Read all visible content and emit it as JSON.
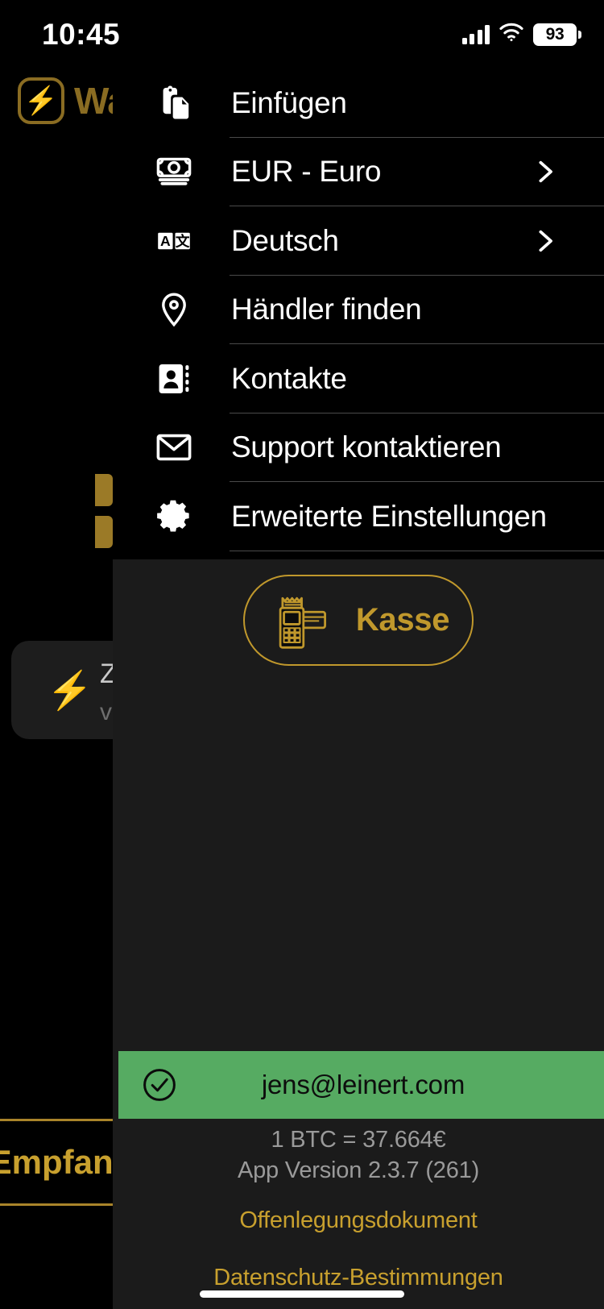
{
  "status_bar": {
    "time": "10:45",
    "signal_icon": "cellular-signal-icon",
    "wifi_icon": "wifi-icon",
    "battery_level": "93",
    "battery_icon": "battery-icon"
  },
  "background": {
    "app_logo_icon": "lightning-bolt-logo-icon",
    "app_logo_glyph": "⚡",
    "app_title": "Wallet",
    "card": {
      "icon": "lightning-bolt-icon",
      "icon_glyph": "⚡",
      "title": "Zahlung",
      "subtitle": "vor"
    },
    "receive_button_label": "Empfangen"
  },
  "drawer": {
    "menu": [
      {
        "label": "Einfügen",
        "icon": "paste-clipboard-icon",
        "chevron": false
      },
      {
        "label": "EUR - Euro",
        "icon": "banknote-icon",
        "chevron": true
      },
      {
        "label": "Deutsch",
        "icon": "translate-icon",
        "chevron": true
      },
      {
        "label": "Händler finden",
        "icon": "map-pin-icon",
        "chevron": false
      },
      {
        "label": "Kontakte",
        "icon": "contact-card-icon",
        "chevron": false
      },
      {
        "label": "Support kontaktieren",
        "icon": "envelope-icon",
        "chevron": false
      },
      {
        "label": "Erweiterte Einstellungen",
        "icon": "gear-icon",
        "chevron": false
      }
    ],
    "kasse_button": {
      "label": "Kasse",
      "icon": "pos-terminal-card-icon"
    },
    "account": {
      "check_icon": "check-circle-icon",
      "email": "jens@leinert.com"
    },
    "footer": {
      "exchange_rate": "1 BTC = 37.664€",
      "app_version": "App Version 2.3.7 (261)",
      "disclosure_link": "Offenlegungsdokument",
      "privacy_link": "Datenschutz-Bestimmungen"
    }
  },
  "colors": {
    "gold": "#c8a02e",
    "gold_dim": "#8a6c22",
    "green_banner": "#56ab62",
    "drawer_bg": "#000000",
    "drawer_lower_bg": "#1b1b1b",
    "separator": "#4a4a4a",
    "muted_text": "#9a9a9a"
  }
}
